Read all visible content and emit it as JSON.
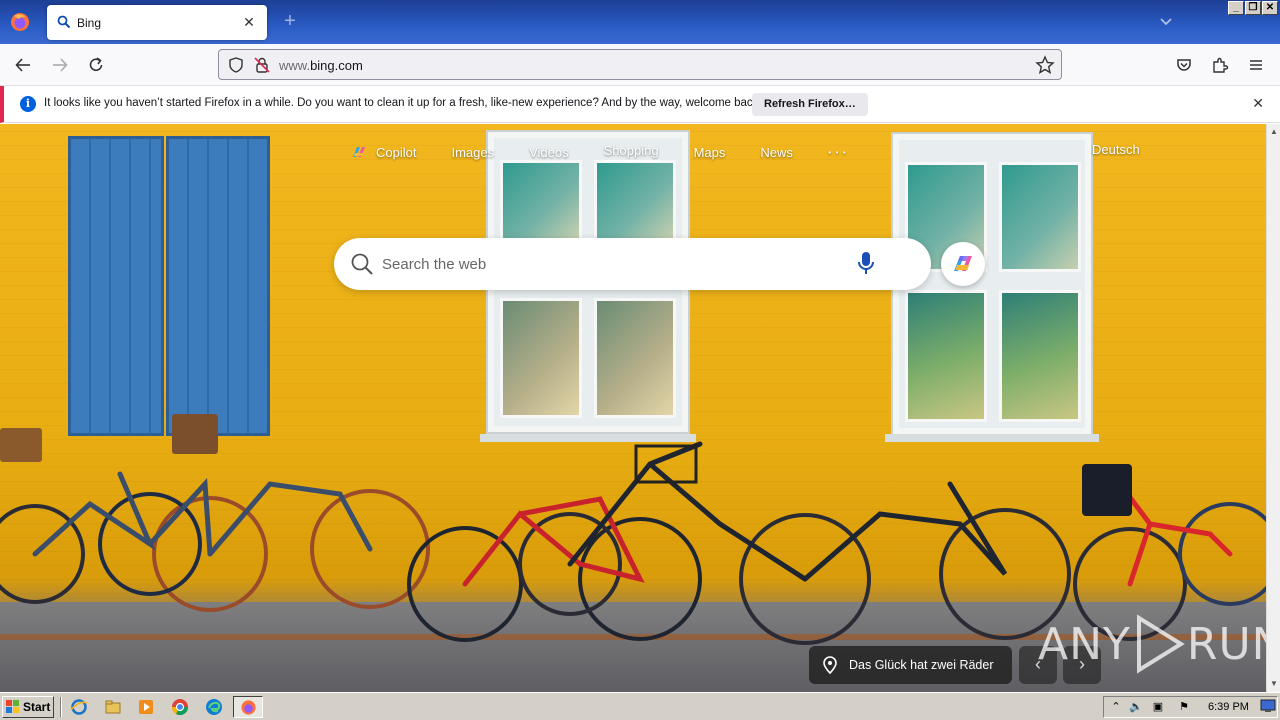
{
  "browser": {
    "tab": {
      "title": "Bing"
    },
    "url": {
      "prefix": "www.",
      "domain": "bing.com"
    },
    "notification": {
      "message": "It looks like you haven’t started Firefox in a while. Do you want to clean it up for a fresh, like-new experience? And by the way, welcome back!",
      "button_label": "Refresh Firefox…"
    }
  },
  "bing": {
    "nav": [
      {
        "label": "Copilot"
      },
      {
        "label": "Images"
      },
      {
        "label": "Videos"
      },
      {
        "label": "Shopping"
      },
      {
        "label": "Maps"
      },
      {
        "label": "News"
      },
      {
        "label": "···"
      }
    ],
    "language_link": "Deutsch",
    "search": {
      "placeholder": "Search the web"
    },
    "image_caption": "Das Glück hat zwei Räder",
    "prev_arrow": "‹",
    "next_arrow": "›"
  },
  "watermark": {
    "text": "ANY",
    "text2": "RUN"
  },
  "taskbar": {
    "start_label": "Start",
    "clock": "6:39 PM"
  },
  "colors": {
    "titlebar": "#2a5bc4",
    "notification_accent": "#e22850",
    "info_blue": "#0060df",
    "wall_yellow": "#efb520",
    "shutter_blue": "#3a76b4"
  }
}
